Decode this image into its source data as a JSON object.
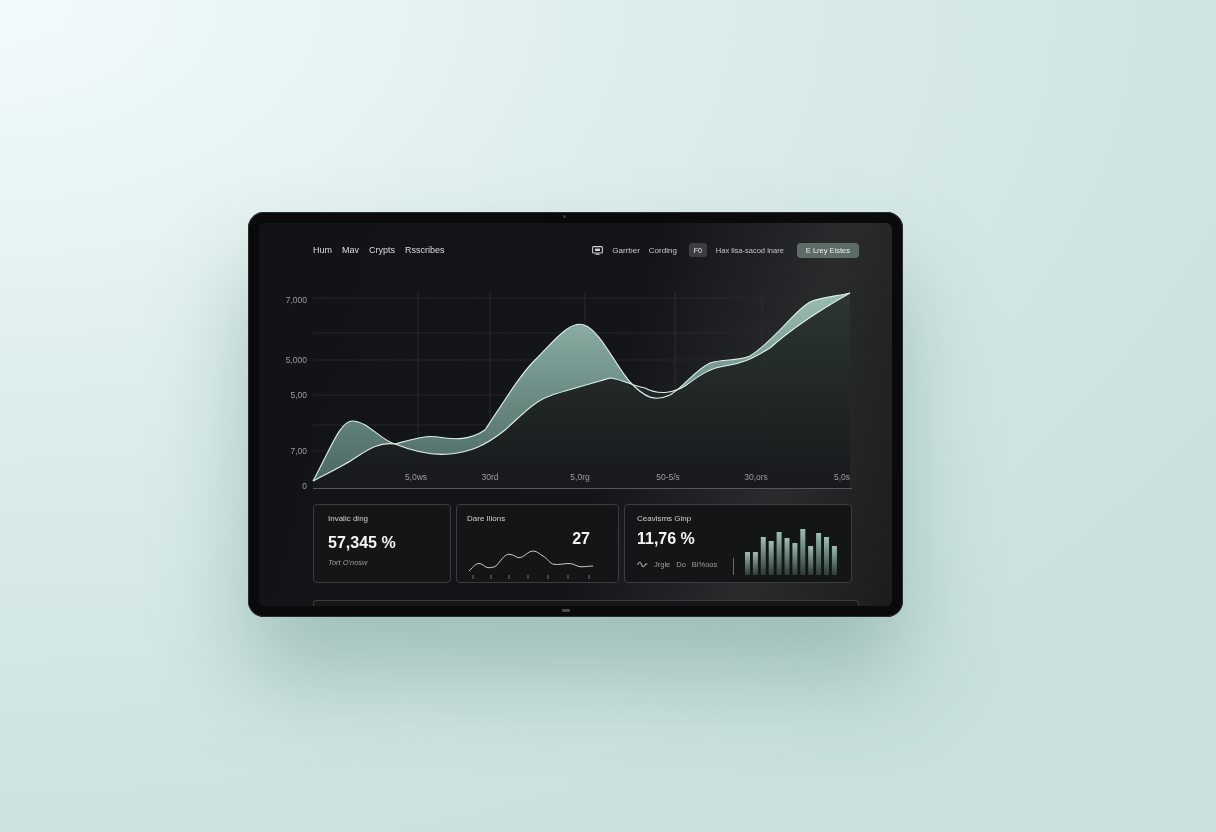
{
  "nav": {
    "links": [
      "Hum",
      "Mav",
      "Crypts",
      "Rsscribes"
    ]
  },
  "toolbar": {
    "links": [
      "Garrber",
      "Cording"
    ],
    "icon_button": "F0",
    "status_text": "Hax lisa-sacod inare",
    "action_button": "E Lrey Eistes"
  },
  "chart": {
    "y_labels": [
      "7,000",
      "5,000",
      "5,00",
      "7,00",
      "0"
    ],
    "x_labels": [
      "5,0ws",
      "30rd",
      "5,0rg",
      "50-5/s",
      "30,ors",
      "5,0s"
    ]
  },
  "cards": [
    {
      "kind": "stat",
      "title": "Invalic ding",
      "value": "57,345 %",
      "note": "Tort O'nosw"
    },
    {
      "kind": "sparkline",
      "title": "Dare Ilions",
      "value": "27"
    },
    {
      "kind": "bars",
      "title": "Ceavisms Ginp",
      "value": "11,76 %",
      "notes": [
        "Jrgle",
        "Do",
        "Bi%oos"
      ]
    }
  ]
}
